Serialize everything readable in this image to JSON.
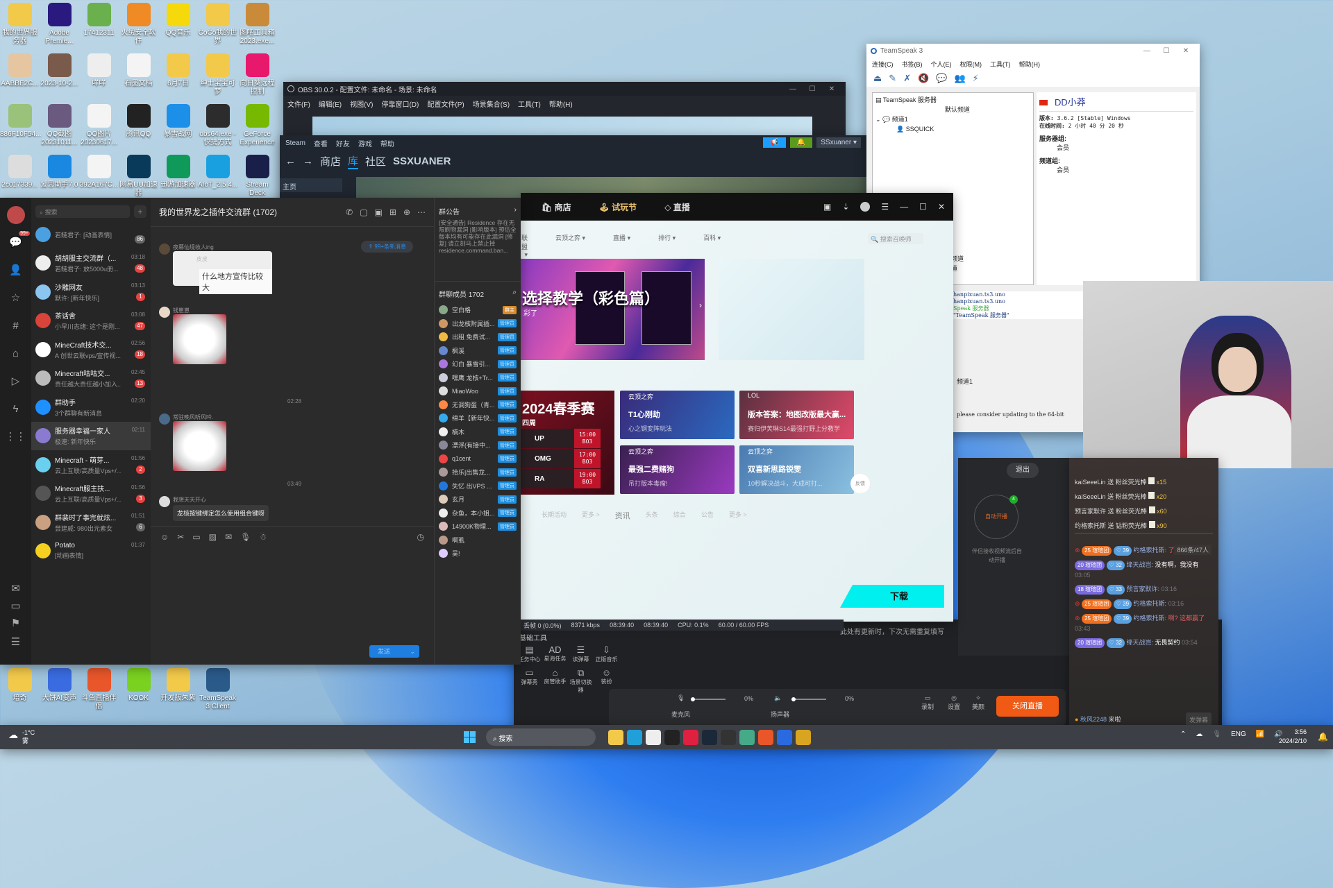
{
  "desktop": {
    "icons": [
      {
        "label": "我的世界服务器",
        "color": "#f3c94a"
      },
      {
        "label": "Adobe Premie...",
        "color": "#2a1a80"
      },
      {
        "label": "17412311",
        "color": "#6ab04c"
      },
      {
        "label": "火绒安全软件",
        "color": "#f08a24"
      },
      {
        "label": "QQ音乐",
        "color": "#f5d90a"
      },
      {
        "label": "CoCo我的世界",
        "color": "#f3c94a"
      },
      {
        "label": "图吧工具箱2023.exe...",
        "color": "#c98b3a"
      },
      {
        "label": "AABBE2C...",
        "color": "#e5c6a0"
      },
      {
        "label": "2023-10-2...",
        "color": "#7a5a4a"
      },
      {
        "label": "咩咩",
        "color": "#eee"
      },
      {
        "label": "石墨文档",
        "color": "#f4f4f4"
      },
      {
        "label": "6月7日",
        "color": "#f3c94a"
      },
      {
        "label": "绅士宝宝可梦",
        "color": "#f3c94a"
      },
      {
        "label": "向日葵远程控制",
        "color": "#e8186c"
      },
      {
        "label": "886F10F54...",
        "color": "#9ac27a"
      },
      {
        "label": "QQ截图20231011...",
        "color": "#6a5a80"
      },
      {
        "label": "QQ图片20230617...",
        "color": "#f4f4f4"
      },
      {
        "label": "腾讯QQ",
        "color": "#222"
      },
      {
        "label": "暴雪战网",
        "color": "#1c8fe8"
      },
      {
        "label": "obs64.exe - 快捷方式",
        "color": "#2c2c2c"
      },
      {
        "label": "GeForce Experience",
        "color": "#76b900"
      },
      {
        "label": "2c017339...",
        "color": "#ddd"
      },
      {
        "label": "爱思助手7.0",
        "color": "#1a88e0"
      },
      {
        "label": "392A167C...",
        "color": "#f4f4f4"
      },
      {
        "label": "网易UU加速器",
        "color": "#0a3a5a"
      },
      {
        "label": "迅游加速器",
        "color": "#0f9a5a"
      },
      {
        "label": "AIoT_2.5.4...",
        "color": "#19a0e0"
      },
      {
        "label": "Stream Deck",
        "color": "#1a1f4a"
      }
    ],
    "bottom_icons": [
      {
        "label": "培奇",
        "color": "#f3c94a"
      },
      {
        "label": "大饼AI变声",
        "color": "#3a6be0"
      },
      {
        "label": "斗鱼直播伴侣",
        "color": "#e8562a"
      },
      {
        "label": "KOOK",
        "color": "#7ad11f"
      },
      {
        "label": "开发版朱紫",
        "color": "#f3c94a"
      },
      {
        "label": "TeamSpeak 3 Client",
        "color": "#2a5a8a"
      }
    ]
  },
  "obs": {
    "title": "OBS 30.0.2 - 配置文件: 未命名 - 场景: 未命名",
    "menu": [
      "文件(F)",
      "编辑(E)",
      "视图(V)",
      "停靠窗口(D)",
      "配置文件(P)",
      "场景集合(S)",
      "工具(T)",
      "帮助(H)"
    ],
    "status": {
      "dropped": "丢帧 0 (0.0%)",
      "bitrate": "8371 kbps",
      "stream_time": "08:39:40",
      "rec_time": "08:39:40",
      "cpu": "CPU: 0.1%",
      "fps": "60.00 / 60.00 FPS"
    }
  },
  "steam": {
    "menu": [
      "Steam",
      "查看",
      "好友",
      "游戏",
      "帮助"
    ],
    "nav": [
      "商店",
      "库",
      "社区",
      "SSXUANER"
    ],
    "active_nav": "库",
    "user": "SSxuaner",
    "home": "主页"
  },
  "teamspeak": {
    "title": "TeamSpeak 3",
    "menu": [
      "连接(C)",
      "书签(B)",
      "个人(E)",
      "权限(M)",
      "工具(T)",
      "帮助(H)"
    ],
    "tree": {
      "server": "TeamSpeak 服务器",
      "default_channel": "默认频道",
      "channel": "频道1",
      "user": "SSQUICK",
      "other1": "员频道",
      "other2": "频道"
    },
    "info": {
      "name": "DD小莽",
      "version_label": "版本:",
      "version": "3.6.2 [Stable] Windows",
      "online_label": "在线时间:",
      "online": "2 小时 40 分 20 秒",
      "server_group_label": "服务器组:",
      "server_group": "会员",
      "channel_group_label": "频道组:",
      "channel_group": "会员"
    },
    "log": [
      "hanpixuan.ts3.uno",
      "hanpixuan.ts3.uno",
      "Speak 服务器",
      "\"TeamSpeak 服务器\""
    ],
    "tab": "频道1",
    "notice": "please consider updating to the 64-bit"
  },
  "qq": {
    "search_placeholder": "搜索",
    "rail_badge": "99+",
    "conversations": [
      {
        "name": "",
        "preview": "若鲢君子: [动画表情]",
        "time": "",
        "badge": "86",
        "grey": true,
        "color": "#4aa0e0"
      },
      {
        "name": "胡胡服主交流群（...",
        "preview": "若鲢君子: 放5000u册...",
        "time": "03:18",
        "badge": "48",
        "color": "#eee"
      },
      {
        "name": "沙雕网友",
        "preview": "默许: [新年快乐]",
        "time": "03:13",
        "badge": "1",
        "color": "#8ac6f0"
      },
      {
        "name": "茶话舍",
        "preview": "小早川志绪: 这个是刚...",
        "time": "03:08",
        "badge": "47",
        "color": "#d8443a"
      },
      {
        "name": "MineCraft技术交...",
        "preview": "A 创世云联vps/宣传视...",
        "time": "02:56",
        "badge": "18",
        "color": "#fff"
      },
      {
        "name": "Minecraft咕咕交...",
        "preview": "责任越大责任越小加入...",
        "time": "02:45",
        "badge": "13",
        "color": "#bbb"
      },
      {
        "name": "群助手",
        "preview": "3个群聊有新消息",
        "time": "02:20",
        "badge": "",
        "color": "#1e90ff"
      },
      {
        "name": "服务器幸福一家人",
        "preview": "极速: 新年快乐",
        "time": "02:11",
        "badge": "",
        "color": "#8a7ad0",
        "selected": true
      },
      {
        "name": "Minecraft - 萌芽...",
        "preview": "云上互联/高质量Vps+/...",
        "time": "01:56",
        "badge": "2",
        "color": "#6ad0f0"
      },
      {
        "name": "Minecraft服主扶...",
        "preview": "云上互联/高质量Vps+/...",
        "time": "01:56",
        "badge": "3",
        "color": "#555"
      },
      {
        "name": "群裴时了事完就炫...",
        "preview": "尝建戚: 980出元素女",
        "time": "01:51",
        "badge": "6",
        "grey": true,
        "color": "#c9a080"
      },
      {
        "name": "Potato",
        "preview": "[动画表情]",
        "time": "01:37",
        "badge": "",
        "color": "#f5d020"
      }
    ],
    "chat": {
      "title": "我的世界龙之插件交流群 (1702)",
      "new_msgs": "99+条新消息",
      "messages": [
        {
          "sender": "夜幕仙境收人ing",
          "quote_name": "皮皮",
          "text": "什么地方宣传比较大"
        },
        {
          "sender": "钱崽崽",
          "type": "sticker"
        },
        {
          "time": "02:28"
        },
        {
          "sender": "常驻晚风听风吟.",
          "type": "sticker"
        },
        {
          "time": "03:49"
        },
        {
          "sender": "我想天天开心",
          "text": "龙核按键绑定怎么使用组合键呀"
        }
      ],
      "send": "发送"
    },
    "side": {
      "notice_title": "群公告",
      "notice": "[安全通告] Residence 存在无限刷物漏洞 [影响版本] 预估全版本均有可能存在此漏洞 [修复] 请立刻马上禁止掉 residence.command.ban...",
      "members_title": "群聊成员 1702",
      "members": [
        {
          "name": "空白格",
          "role": "群主",
          "owner": true
        },
        {
          "name": "出龙核附属插...",
          "role": "管理员"
        },
        {
          "name": "出租 免费试...",
          "role": "管理员"
        },
        {
          "name": "枫溪",
          "role": "管理员"
        },
        {
          "name": "幻白 暴雪引...",
          "role": "管理员"
        },
        {
          "name": "嘿鹰 龙核+Tr...",
          "role": "管理员"
        },
        {
          "name": "MiaoWoo",
          "role": "管理员"
        },
        {
          "name": "无调狗蛋（青...",
          "role": "管理员"
        },
        {
          "name": "绵羊【新年快...",
          "role": "管理员"
        },
        {
          "name": "楠木",
          "role": "管理员"
        },
        {
          "name": "漂浮(有接中...",
          "role": "管理员"
        },
        {
          "name": "q1cent",
          "role": "管理员"
        },
        {
          "name": "拾乐|出售龙...",
          "role": "管理员"
        },
        {
          "name": "失忆 出VPS ...",
          "role": "管理员"
        },
        {
          "name": "玄月",
          "role": "管理员"
        },
        {
          "name": "杂鱼，本小姐...",
          "role": "管理员"
        },
        {
          "name": "14900K物理...",
          "role": "管理员"
        },
        {
          "name": "啊虱",
          "role": ""
        },
        {
          "name": "吴!",
          "role": ""
        }
      ]
    }
  },
  "wegame": {
    "nav": [
      "商店",
      "试玩节",
      "直播"
    ],
    "subnav": [
      "联盟",
      "云顶之弈",
      "直播",
      "排行",
      "百科"
    ],
    "search_placeholder": "搜索召唤师",
    "banner": {
      "title": "选择教学（彩色篇）",
      "sub": "彩了"
    },
    "schedule": {
      "title": "2024春季赛",
      "week": "四周",
      "matches": [
        {
          "team": "UP",
          "time": "15:00",
          "bo": "BO3"
        },
        {
          "team": "OMG",
          "time": "17:00",
          "bo": "BO3"
        },
        {
          "team": "RA",
          "time": "19:00",
          "bo": "BO3"
        }
      ]
    },
    "cards": [
      {
        "tag": "云顶之弈",
        "title": "T1心刚劫",
        "sub": "心之钢变阵玩法",
        "colors": [
          "#3a2a7a",
          "#2a6ac0"
        ]
      },
      {
        "tag": "LOL",
        "title": "版本答案：地图改版最大赢...",
        "sub": "赛归伊芙琳S14最强打野上分教学",
        "colors": [
          "#5a3040",
          "#e04a6a"
        ]
      },
      {
        "tag": "云顶之弈",
        "title": "最强二费赌狗",
        "sub": "吊打版本毒瘤!",
        "colors": [
          "#3a2050",
          "#9a3ac0"
        ]
      },
      {
        "tag": "云顶之弈",
        "title": "双喜新思路锐雯",
        "sub": "10秒解决战斗，大成可打...",
        "colors": [
          "#4a7ab0",
          "#8ac0e0"
        ]
      }
    ],
    "tabs": [
      "长期活动",
      "更多 >",
      "资讯",
      "头条",
      "综合",
      "公告",
      "更多 >"
    ],
    "feedback": "反馈",
    "download": "下载"
  },
  "live": {
    "tools_title": "基础工具",
    "notice": "此处有更新时，下次无需重复填写",
    "tools": [
      "任务中心",
      "星海任务",
      "读弹幕",
      "正版音乐",
      "弹幕秀",
      "房管助手",
      "场景切换器",
      "装扮"
    ],
    "exit": "退出",
    "auto_start": "自动开播",
    "auto_badge": "4",
    "auto_hint": "伴侣接收视频流后自动开播",
    "mic": "麦克风",
    "mic_level": "0%",
    "speaker": "扬声器",
    "speaker_level": "0%",
    "record": "录制",
    "settings": "设置",
    "beauty": "美颜",
    "stop": "关闭直播",
    "gifts": [
      {
        "user": "kaiSeeeLin",
        "act": "送 粉丝荧光棒",
        "count": "x15"
      },
      {
        "user": "kaiSeeeLin",
        "act": "送 粉丝荧光棒",
        "count": "x20"
      },
      {
        "user": "预言家默许",
        "act": "送 粉丝荧光棒",
        "count": "x60"
      },
      {
        "user": "约格索托斯",
        "act": "送 钻粉荧光棒",
        "count": "x90"
      }
    ],
    "stats": "866条/47人",
    "danmaku": [
      {
        "lv": "25",
        "club": "瑄瑄团",
        "fan": "39",
        "user": "约格索托斯:",
        "text": "了",
        "time": "02:54",
        "room": true
      },
      {
        "lv": "20",
        "club": "瑄瑄团",
        "fan": "32",
        "user": "绛天战岂:",
        "text": "没有啊，我没有",
        "time": "03:05"
      },
      {
        "lv": "18",
        "club": "瑄瑄团",
        "fan": "33",
        "user": "预言家默许:",
        "text": "",
        "time": "03:16"
      },
      {
        "lv": "25",
        "club": "瑄瑄团",
        "fan": "39",
        "user": "约格索托斯:",
        "text": "",
        "time": "03:16",
        "room": true
      },
      {
        "lv": "25",
        "club": "瑄瑄团",
        "fan": "39",
        "user": "约格索托斯:",
        "text": "啊? 这都赢了",
        "time": "03:43",
        "room": true
      },
      {
        "lv": "20",
        "club": "瑄瑄团",
        "fan": "32",
        "user": "绛天战岂:",
        "text": "无畏契约",
        "time": "03:54"
      }
    ],
    "enter": {
      "user": "秋风2248",
      "text": "来啦"
    },
    "send_danmaku": "发弹幕"
  },
  "taskbar": {
    "weather": {
      "temp": "-1°C",
      "cond": "雾"
    },
    "search": "搜索",
    "lang": "ENG",
    "time": "3:56",
    "date": "2024/2/10",
    "apps": [
      {
        "name": "file-explorer",
        "color": "#f3c94a"
      },
      {
        "name": "edge",
        "color": "#1fa0d8"
      },
      {
        "name": "store",
        "color": "#eee"
      },
      {
        "name": "qq",
        "color": "#222"
      },
      {
        "name": "netease-music",
        "color": "#e02040"
      },
      {
        "name": "steam",
        "color": "#1b2838"
      },
      {
        "name": "obs",
        "color": "#333"
      },
      {
        "name": "chrome",
        "color": "#4a8"
      },
      {
        "name": "douyu",
        "color": "#e8562a"
      },
      {
        "name": "teamspeak",
        "color": "#2a6ae0"
      },
      {
        "name": "wegame",
        "color": "#d9a520"
      }
    ]
  }
}
